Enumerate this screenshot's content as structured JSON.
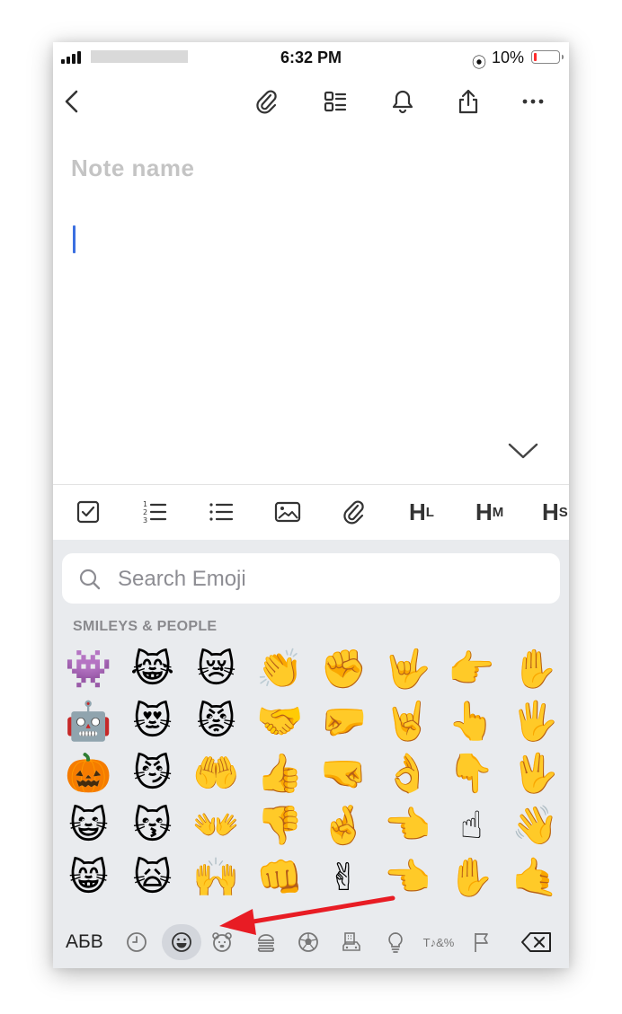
{
  "status": {
    "time": "6:32 PM",
    "battery_percent": "10%",
    "battery_level": 0.1,
    "orientation_lock_icon": "orientation-lock-icon",
    "lock_glyph": "⦿"
  },
  "toolbar": {
    "icons": [
      "back-icon",
      "attach-icon",
      "layout-icon",
      "bell-icon",
      "share-icon",
      "more-icon"
    ]
  },
  "note": {
    "title_placeholder": "Note name"
  },
  "formatbar": {
    "icons": [
      "checkbox-icon",
      "numbered-list-icon",
      "bullet-list-icon",
      "image-icon",
      "attach-icon"
    ],
    "heading_large": "H",
    "heading_large_sub": "L",
    "heading_medium": "H",
    "heading_medium_sub": "M",
    "heading_small": "H",
    "heading_small_sub": "S"
  },
  "keyboard": {
    "search_placeholder": "Search Emoji",
    "section_title": "SMILEYS & PEOPLE",
    "rows": [
      [
        "👾",
        "😹",
        "😿",
        "👏",
        "✊",
        "🤟",
        "👉",
        "✋"
      ],
      [
        "🤖",
        "😻",
        "😾",
        "🤝",
        "🤛",
        "🤘",
        "👆",
        "🖐"
      ],
      [
        "🎃",
        "😼",
        "🤲",
        "👍",
        "🤜",
        "👌",
        "👇",
        "🖖"
      ],
      [
        "😺",
        "😽",
        "👐",
        "👎",
        "🤞",
        "👈",
        "☝",
        "👋"
      ],
      [
        "😸",
        "🙀",
        "🙌",
        "👊",
        "✌",
        "👈",
        "✋",
        "🤙"
      ]
    ],
    "lang_key": "АБВ",
    "categories": [
      "recent-icon",
      "smiley-icon",
      "animal-icon",
      "food-icon",
      "activity-icon",
      "travel-icon",
      "objects-icon",
      "symbols-icon",
      "flag-icon"
    ],
    "symbols_glyph": "T♪&%",
    "delete_icon": "backspace-icon"
  },
  "colors": {
    "accent_cursor": "#3b6fe0",
    "annotation_arrow": "#e81c24",
    "keyboard_bg": "#e9ebee"
  }
}
